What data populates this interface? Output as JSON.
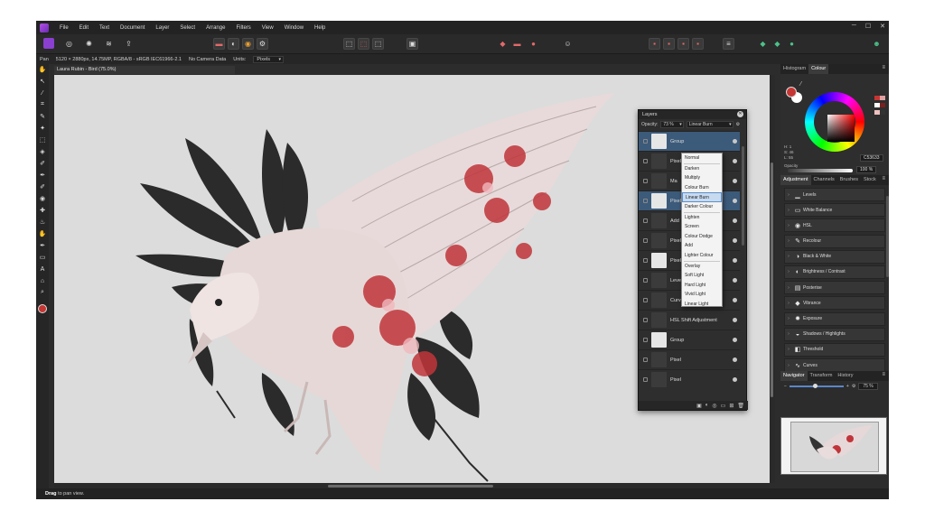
{
  "menubar": {
    "items": [
      "File",
      "Edit",
      "Text",
      "Document",
      "Layer",
      "Select",
      "Arrange",
      "Filters",
      "View",
      "Window",
      "Help"
    ]
  },
  "context_bar": {
    "tool": "Pan",
    "doc_info": "5120 × 2880px, 14.75MP, RGBA/8 - sRGB IEC61966-2.1",
    "camera": "No Camera Data",
    "units_label": "Units:",
    "units_value": "Pixels"
  },
  "document": {
    "tab_title": "Laura Rubin - Bird (75.0%)"
  },
  "status": {
    "action": "Drag",
    "hint": "to pan view."
  },
  "layers_panel": {
    "title": "Layers",
    "opacity_label": "Opacity:",
    "opacity_value": "73 %",
    "blend_mode": "Linear Burn",
    "rows": [
      {
        "label": "Group",
        "selected": true
      },
      {
        "label": "Pixel",
        "selected": false
      },
      {
        "label": "Ma",
        "selected": false
      },
      {
        "label": "Pixel",
        "selected": true
      },
      {
        "label": "Add",
        "selected": false
      },
      {
        "label": "Pixel",
        "selected": false
      },
      {
        "label": "Pixel",
        "selected": false
      },
      {
        "label": "Levels Adjustment",
        "selected": false
      },
      {
        "label": "Curves Adjustment",
        "selected": false
      },
      {
        "label": "HSL Shift Adjustment",
        "selected": false
      },
      {
        "label": "Group",
        "selected": false
      },
      {
        "label": "Pixel",
        "selected": false
      },
      {
        "label": "Pixel",
        "selected": false
      }
    ]
  },
  "blend_menu": {
    "groups": [
      [
        "Normal"
      ],
      [
        "Darken",
        "Multiply",
        "Colour Burn",
        "Linear Burn",
        "Darker Colour"
      ],
      [
        "Lighten",
        "Screen",
        "Colour Dodge",
        "Add",
        "Lighter Colour"
      ],
      [
        "Overlay",
        "Soft Light",
        "Hard Light",
        "Vivid Light",
        "Linear Light"
      ]
    ],
    "selected": "Linear Burn"
  },
  "colour_panel": {
    "tabs": [
      "Histogram",
      "Colour"
    ],
    "active_tab": "Colour",
    "readout": [
      "H: 1",
      "S: 46",
      "L: 55"
    ],
    "hex": "C53633",
    "opacity_label": "Opacity",
    "opacity_value": "100 %",
    "fg_color": "#c53633",
    "bg_color": "#ffffff"
  },
  "adjustment_panel": {
    "tabs": [
      "Adjustment",
      "Channels",
      "Brushes",
      "Stock"
    ],
    "active_tab": "Adjustment",
    "items": [
      {
        "label": "Levels",
        "icon": "levels-icon"
      },
      {
        "label": "White Balance",
        "icon": "white-balance-icon"
      },
      {
        "label": "HSL",
        "icon": "hsl-icon"
      },
      {
        "label": "Recolour",
        "icon": "recolour-icon"
      },
      {
        "label": "Black & White",
        "icon": "black-white-icon"
      },
      {
        "label": "Brightness / Contrast",
        "icon": "brightness-icon"
      },
      {
        "label": "Posterise",
        "icon": "posterise-icon"
      },
      {
        "label": "Vibrance",
        "icon": "vibrance-icon"
      },
      {
        "label": "Exposure",
        "icon": "exposure-icon"
      },
      {
        "label": "Shadows / Highlights",
        "icon": "shadows-icon"
      },
      {
        "label": "Threshold",
        "icon": "threshold-icon"
      },
      {
        "label": "Curves",
        "icon": "curves-icon"
      }
    ]
  },
  "navigator_panel": {
    "tabs": [
      "Navigator",
      "Transform",
      "History"
    ],
    "active_tab": "Navigator",
    "zoom_value": "75 %"
  }
}
